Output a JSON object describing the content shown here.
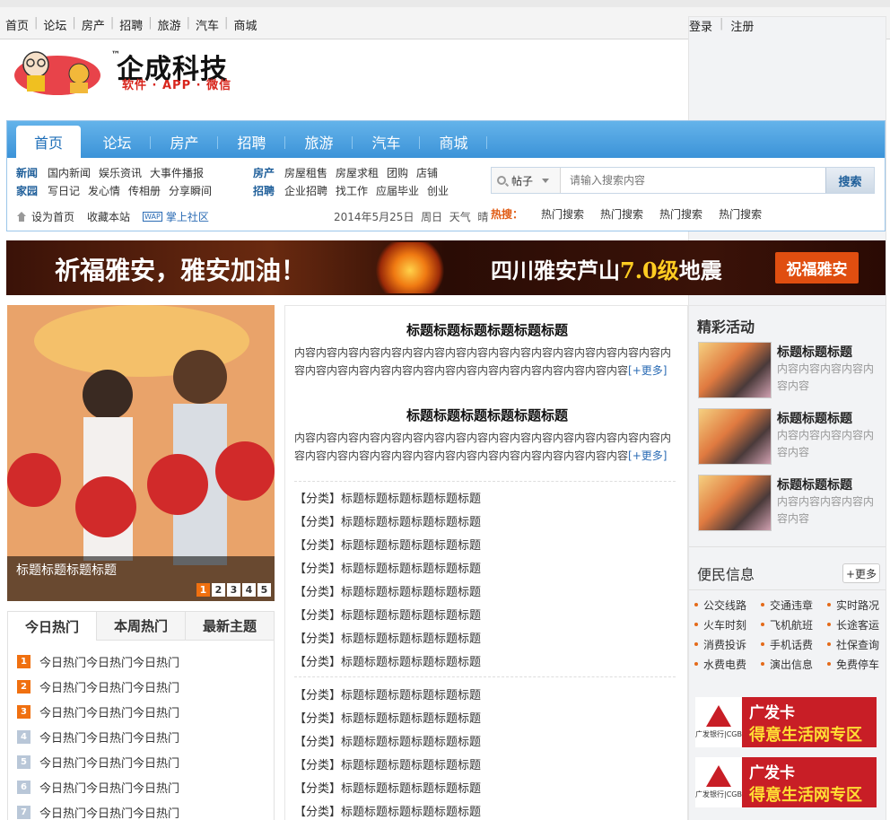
{
  "topbar": {
    "links": [
      "首页",
      "论坛",
      "房产",
      "招聘",
      "旅游",
      "汽车",
      "商城"
    ],
    "login": "登录",
    "register": "注册"
  },
  "logo": {
    "tm": "™",
    "name": "企成科技",
    "tagline": "软件 · APP · 微信"
  },
  "nav": {
    "tabs": [
      "首页",
      "论坛",
      "房产",
      "招聘",
      "旅游",
      "汽车",
      "商城"
    ],
    "active_tab": "首页"
  },
  "subnav": {
    "rows": [
      {
        "cat": "新闻",
        "items": [
          "国内新闻",
          "娱乐资讯",
          "大事件播报"
        ]
      },
      {
        "cat": "家园",
        "items": [
          "写日记",
          "发心情",
          "传相册",
          "分享瞬间"
        ]
      }
    ],
    "rows2": [
      {
        "cat": "房产",
        "items": [
          "房屋租售",
          "房屋求租",
          "团购",
          "店铺"
        ]
      },
      {
        "cat": "招聘",
        "items": [
          "企业招聘",
          "找工作",
          "应届毕业",
          "创业"
        ]
      }
    ]
  },
  "tools": {
    "set_home": "设为首页",
    "favorite": "收藏本站",
    "wap_icon": "WAP",
    "mobile": "掌上社区",
    "date": "2014年5月25日",
    "weekday": "周日",
    "weather_label": "天气",
    "weather": "晴"
  },
  "search": {
    "type": "帖子",
    "placeholder": "请输入搜索内容",
    "button": "搜索",
    "hot_label": "热搜：",
    "hot_keywords": [
      "热门搜索",
      "热门搜索",
      "热门搜索",
      "热门搜索"
    ]
  },
  "banner": {
    "text1": "祈福雅安，雅安加油！",
    "text2_pre": "四川雅安芦山",
    "text2_hl": "7.0级",
    "text2_post": "地震",
    "button": "祝福雅安"
  },
  "slide": {
    "caption": "标题标题标题标题",
    "dots": [
      "1",
      "2",
      "3",
      "4",
      "5"
    ],
    "active_dot": 0
  },
  "hotbox": {
    "tabs": [
      "今日热门",
      "本周热门",
      "最新主题"
    ],
    "items": [
      {
        "n": "1",
        "text": "今日热门今日热门今日热门"
      },
      {
        "n": "2",
        "text": "今日热门今日热门今日热门"
      },
      {
        "n": "3",
        "text": "今日热门今日热门今日热门"
      },
      {
        "n": "4",
        "text": "今日热门今日热门今日热门"
      },
      {
        "n": "5",
        "text": "今日热门今日热门今日热门"
      },
      {
        "n": "6",
        "text": "今日热门今日热门今日热门"
      },
      {
        "n": "7",
        "text": "今日热门今日热门今日热门"
      }
    ]
  },
  "middle": {
    "features": [
      {
        "title": "标题标题标题标题标题标题",
        "content": "内容内容内容内容内容内容内容内容内容内容内容内容内容内容内容内容内容内容内容内容内容内容内容内容内容内容内容内容内容内容内容内容内容",
        "more": "[+更多]"
      },
      {
        "title": "标题标题标题标题标题标题",
        "content": "内容内容内容内容内容内容内容内容内容内容内容内容内容内容内容内容内容内容内容内容内容内容内容内容内容内容内容内容内容内容内容内容内容",
        "more": "[+更多]"
      }
    ],
    "list1": [
      "【分类】标题标题标题标题标题标题",
      "【分类】标题标题标题标题标题标题",
      "【分类】标题标题标题标题标题标题",
      "【分类】标题标题标题标题标题标题",
      "【分类】标题标题标题标题标题标题",
      "【分类】标题标题标题标题标题标题",
      "【分类】标题标题标题标题标题标题",
      "【分类】标题标题标题标题标题标题"
    ],
    "list2": [
      "【分类】标题标题标题标题标题标题",
      "【分类】标题标题标题标题标题标题",
      "【分类】标题标题标题标题标题标题",
      "【分类】标题标题标题标题标题标题",
      "【分类】标题标题标题标题标题标题",
      "【分类】标题标题标题标题标题标题"
    ]
  },
  "right": {
    "activities_title": "精彩活动",
    "activities": [
      {
        "title": "标题标题标题",
        "content": "内容内容内容内容内容内容"
      },
      {
        "title": "标题标题标题",
        "content": "内容内容内容内容内容内容"
      },
      {
        "title": "标题标题标题",
        "content": "内容内容内容内容内容内容"
      }
    ],
    "services_title": "便民信息",
    "more": "+更多",
    "services": [
      "公交线路",
      "交通违章",
      "实时路况",
      "火车时刻",
      "飞机航班",
      "长途客运",
      "消费投诉",
      "手机话费",
      "社保查询",
      "水费电费",
      "演出信息",
      "免费停车"
    ],
    "ad": {
      "line1": "广发卡",
      "line2": "得意生活网专区",
      "bank": "广发银行|CGB"
    }
  },
  "colors": {
    "nav_blue": "#3c93d8",
    "accent_orange": "#f07010",
    "ad_red": "#c81e26"
  }
}
